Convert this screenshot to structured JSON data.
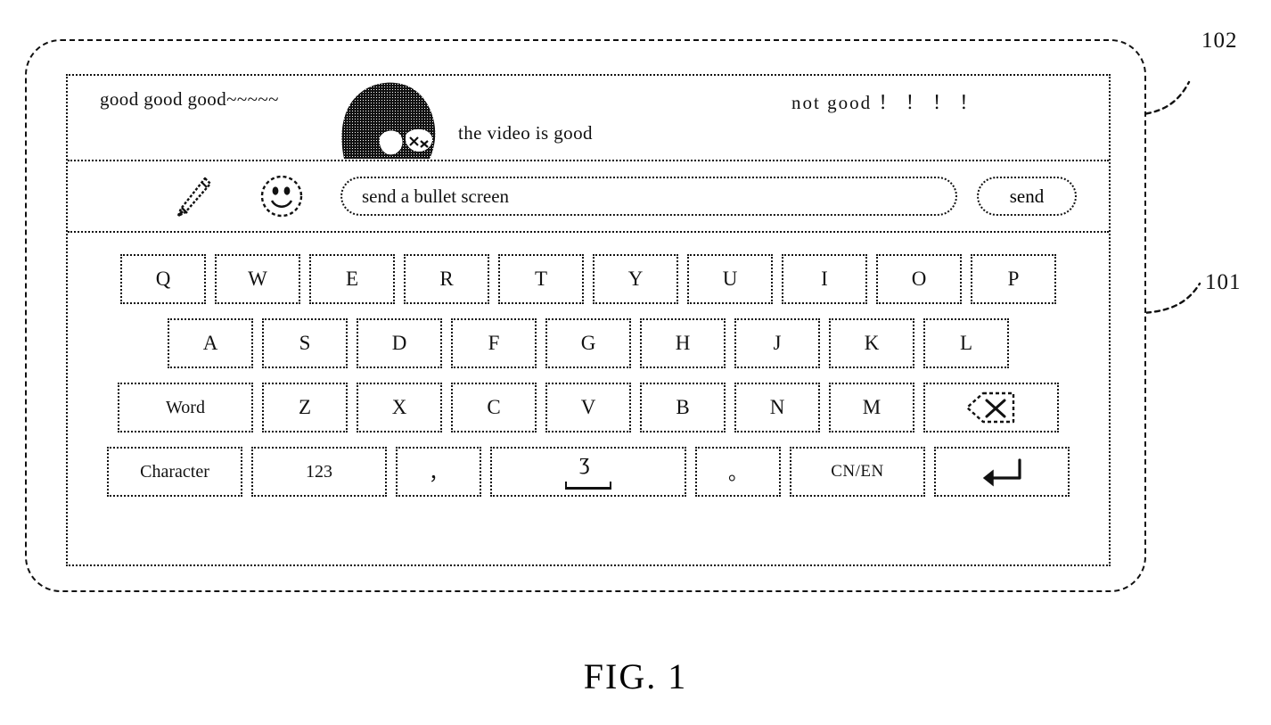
{
  "figure": {
    "caption": "FIG. 1",
    "reference_numbers": [
      {
        "id": "102",
        "label": "102",
        "points_to": "bullet-screen-comment-area"
      },
      {
        "id": "101",
        "label": "101",
        "points_to": "virtual-keyboard"
      }
    ]
  },
  "comment_area": {
    "comments": [
      {
        "text": "good good good~~~~~"
      },
      {
        "text": "not good ！ ！ ！ ！"
      },
      {
        "text": "the video is good"
      }
    ],
    "sticker": "dark-hair-avatar-sticker"
  },
  "input_bar": {
    "pen_icon": "pen-icon",
    "emoji_icon": "smiley-face-icon",
    "input_placeholder": "send a bullet screen",
    "input_value": "",
    "send_label": "send"
  },
  "keyboard": {
    "rows": [
      {
        "name": "row-1",
        "keys": [
          {
            "label": "Q",
            "type": "letter"
          },
          {
            "label": "W",
            "type": "letter"
          },
          {
            "label": "E",
            "type": "letter"
          },
          {
            "label": "R",
            "type": "letter"
          },
          {
            "label": "T",
            "type": "letter"
          },
          {
            "label": "Y",
            "type": "letter"
          },
          {
            "label": "U",
            "type": "letter"
          },
          {
            "label": "I",
            "type": "letter"
          },
          {
            "label": "O",
            "type": "letter"
          },
          {
            "label": "P",
            "type": "letter"
          }
        ]
      },
      {
        "name": "row-2",
        "keys": [
          {
            "label": "A",
            "type": "letter"
          },
          {
            "label": "S",
            "type": "letter"
          },
          {
            "label": "D",
            "type": "letter"
          },
          {
            "label": "F",
            "type": "letter"
          },
          {
            "label": "G",
            "type": "letter"
          },
          {
            "label": "H",
            "type": "letter"
          },
          {
            "label": "J",
            "type": "letter"
          },
          {
            "label": "K",
            "type": "letter"
          },
          {
            "label": "L",
            "type": "letter"
          }
        ]
      },
      {
        "name": "row-3",
        "keys": [
          {
            "label": "Word",
            "type": "wide"
          },
          {
            "label": "Z",
            "type": "letter"
          },
          {
            "label": "X",
            "type": "letter"
          },
          {
            "label": "C",
            "type": "letter"
          },
          {
            "label": "V",
            "type": "letter"
          },
          {
            "label": "B",
            "type": "letter"
          },
          {
            "label": "N",
            "type": "letter"
          },
          {
            "label": "M",
            "type": "letter"
          },
          {
            "label": "",
            "type": "back",
            "icon": "backspace-icon"
          }
        ]
      },
      {
        "name": "row-4",
        "keys": [
          {
            "label": "Character",
            "type": "wide"
          },
          {
            "label": "123",
            "type": "wide"
          },
          {
            "label": "，",
            "type": "sym"
          },
          {
            "label": "",
            "type": "space",
            "icon": "space-icon"
          },
          {
            "label": "。",
            "type": "sym"
          },
          {
            "label": "CN/EN",
            "type": "cnen"
          },
          {
            "label": "",
            "type": "enter",
            "icon": "enter-icon"
          }
        ]
      }
    ]
  }
}
